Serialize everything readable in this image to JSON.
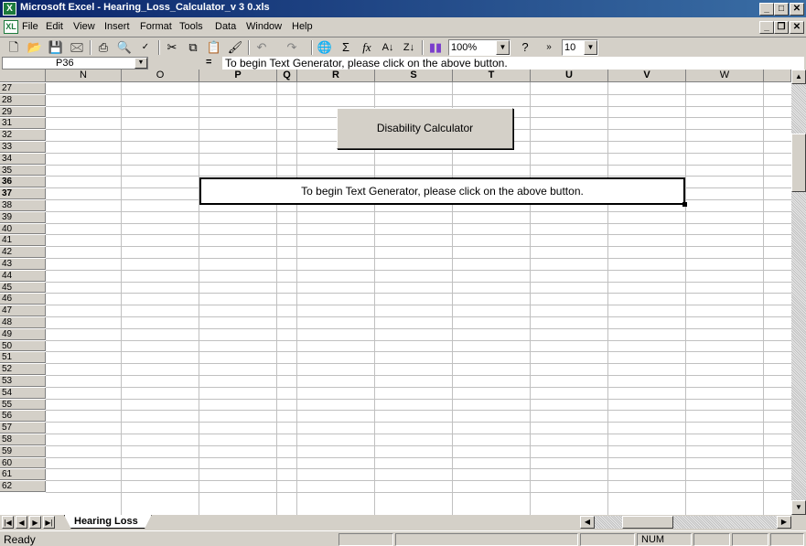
{
  "window": {
    "title": "Microsoft Excel - Hearing_Loss_Calculator_v 3 0.xls",
    "app_icon": "excel-app-icon"
  },
  "menu": [
    "File",
    "Edit",
    "View",
    "Insert",
    "Format",
    "Tools",
    "Data",
    "Window",
    "Help"
  ],
  "toolbar": {
    "zoom": "100%",
    "font_size": "10"
  },
  "formula_bar": {
    "cell_ref": "P36",
    "equals": "=",
    "formula": "To begin Text Generator, please click on the above button."
  },
  "columns": [
    {
      "letter": "N",
      "bold": false
    },
    {
      "letter": "O",
      "bold": false
    },
    {
      "letter": "P",
      "bold": true
    },
    {
      "letter": "Q",
      "bold": true
    },
    {
      "letter": "R",
      "bold": true
    },
    {
      "letter": "S",
      "bold": true
    },
    {
      "letter": "T",
      "bold": true
    },
    {
      "letter": "U",
      "bold": true
    },
    {
      "letter": "V",
      "bold": true
    },
    {
      "letter": "W",
      "bold": false
    }
  ],
  "rows": [
    "27",
    "28",
    "29",
    "31",
    "32",
    "33",
    "34",
    "35",
    "36",
    "37",
    "38",
    "39",
    "40",
    "41",
    "42",
    "43",
    "44",
    "45",
    "46",
    "47",
    "48",
    "49",
    "50",
    "51",
    "52",
    "53",
    "54",
    "55",
    "56",
    "57",
    "58",
    "59",
    "60",
    "61",
    "62"
  ],
  "active_rows": [
    "36",
    "37"
  ],
  "button": {
    "label": "Disability Calculator"
  },
  "message": "To begin Text Generator, please click on the above button.",
  "sheet_tab": "Hearing Loss",
  "status": {
    "text": "Ready",
    "num": "NUM"
  }
}
